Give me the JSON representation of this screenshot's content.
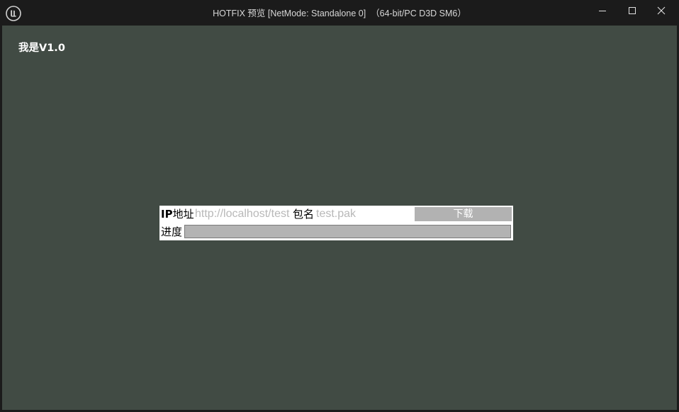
{
  "window": {
    "title": "HOTFIX 预览 [NetMode: Standalone 0]  （64-bit/PC D3D SM6）",
    "buttons": {
      "minimize_icon": "minimize-icon",
      "maximize_icon": "maximize-icon",
      "close_icon": "close-icon"
    },
    "logo_icon": "unreal-engine-logo-icon"
  },
  "viewport": {
    "background": "#414b44",
    "version_label": "我是V1.0"
  },
  "panel": {
    "ip_label_bold": "IP",
    "ip_label_rest": "地址",
    "ip_placeholder": "http://localhost/test",
    "ip_value": "",
    "package_label": "包名",
    "package_placeholder": "test.pak",
    "package_value": "",
    "download_label": "下载",
    "progress_label": "进度",
    "progress_value": 0
  },
  "colors": {
    "titlebar": "#1b1b1b",
    "viewport": "#414b44",
    "panel": "#ffffff",
    "button": "#b2b2b2",
    "progress_track": "#b3b3b3"
  }
}
